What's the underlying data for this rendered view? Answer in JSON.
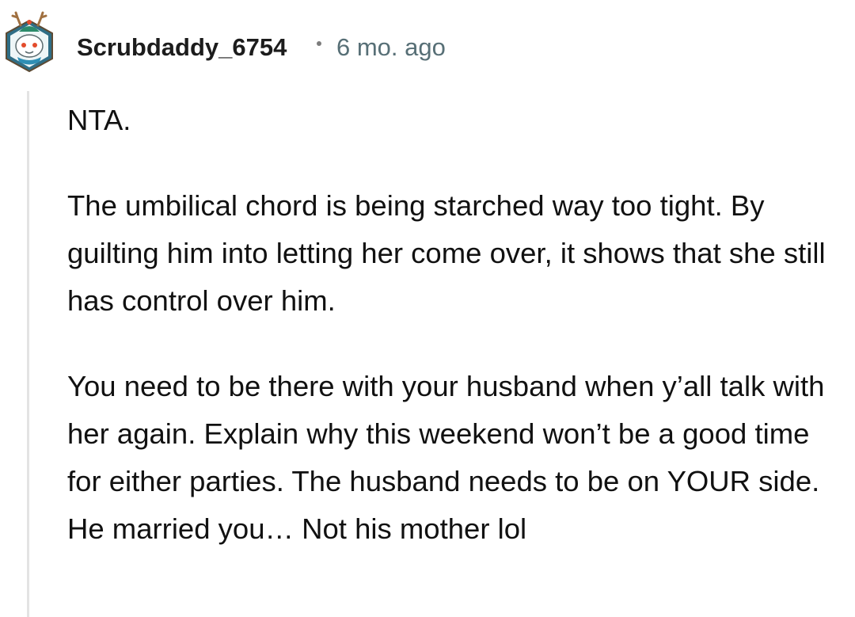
{
  "comment": {
    "author": "Scrubdaddy_6754",
    "separator": "•",
    "timestamp": "6 mo. ago",
    "avatar_icon": "snoo-avatar-icon",
    "paragraphs": [
      "NTA.",
      "The umbilical chord is being starched way too tight. By guilting him into letting her come over, it shows that she still has control over him.",
      "You need to be there with your husband when y’all talk with her again. Explain why this weekend won’t be a good time for either parties. The husband needs to be on YOUR side. He married you… Not his mother lol"
    ]
  },
  "colors": {
    "username": "#1c1c1c",
    "timestamp": "#576f76",
    "thread_line": "#e3e3e3",
    "avatar_bg": "#2f6e86"
  }
}
